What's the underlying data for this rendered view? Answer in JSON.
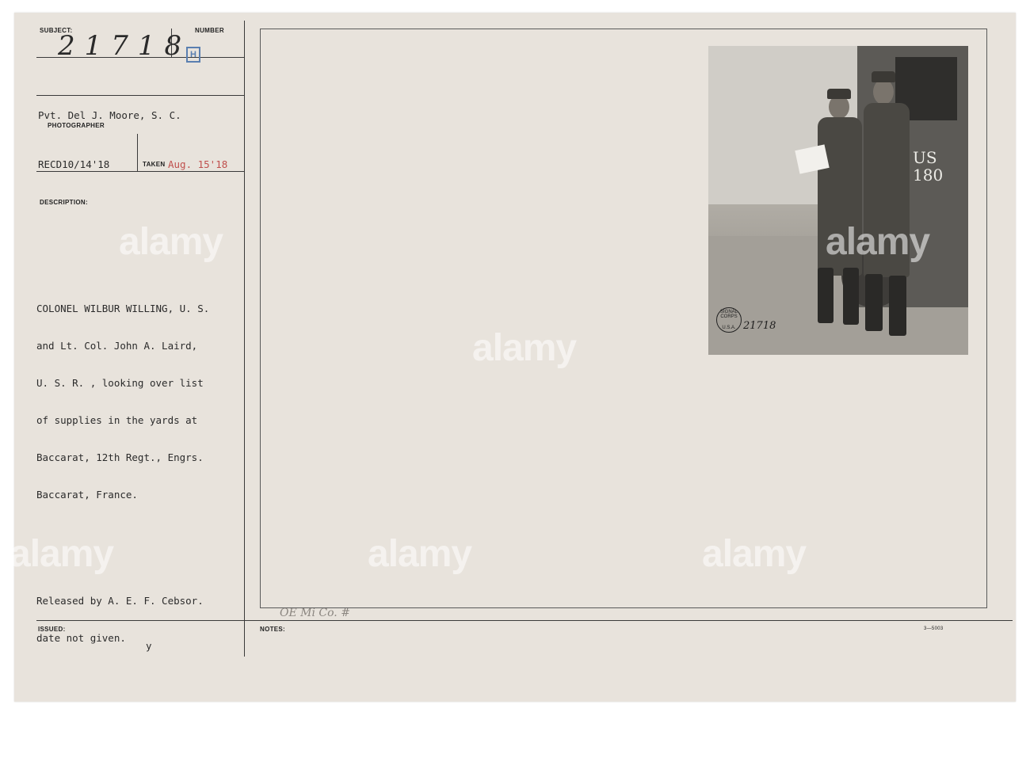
{
  "labels": {
    "subject": "SUBJECT:",
    "number": "NUMBER",
    "photographer": "PHOTOGRAPHER",
    "taken": "TAKEN",
    "description": "DESCRIPTION:",
    "issued": "ISSUED:",
    "notes": "NOTES:"
  },
  "record": {
    "subject_number": "21718",
    "number_stamp": "H",
    "photographer_name": "Pvt. Del J. Moore, S. C.",
    "received_date": "RECD10/14'18",
    "taken_date": "Aug. 15'18",
    "description_lines": [
      "COLONEL WILBUR WILLING, U. S.",
      "and Lt. Col. John A. Laird,",
      "U. S. R. , looking over list",
      "of supplies in the yards at",
      "Baccarat, 12th Regt., Engrs.",
      "Baccarat, France."
    ],
    "release_lines": [
      "Released by A. E. F. Cebsor.",
      "date not given."
    ],
    "issued_mark": "y",
    "notes_handwriting": "OE Mi Co. #",
    "form_code": "3—5003"
  },
  "photo": {
    "truck_label_line1": "US",
    "truck_label_line2": "180",
    "stamp_top": "SIGNAL CORPS",
    "stamp_bottom": "U.S.A.",
    "photo_number": "21718"
  },
  "watermark": "alamy"
}
